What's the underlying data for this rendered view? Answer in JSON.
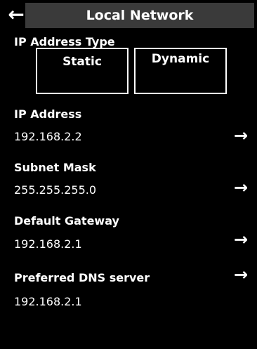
{
  "header": {
    "back_icon": "←",
    "title": "Local Network"
  },
  "ip_type": {
    "label": "IP Address Type",
    "options": [
      "Static",
      "Dynamic"
    ]
  },
  "fields": [
    {
      "label": "IP Address",
      "value": "192.168.2.2",
      "arrow": "→"
    },
    {
      "label": "Subnet Mask",
      "value": "255.255.255.0",
      "arrow": "→"
    },
    {
      "label": "Default Gateway",
      "value": "192.168.2.1",
      "arrow": "→"
    },
    {
      "label": "Preferred DNS server",
      "value": "192.168.2.1",
      "arrow": "→"
    }
  ]
}
